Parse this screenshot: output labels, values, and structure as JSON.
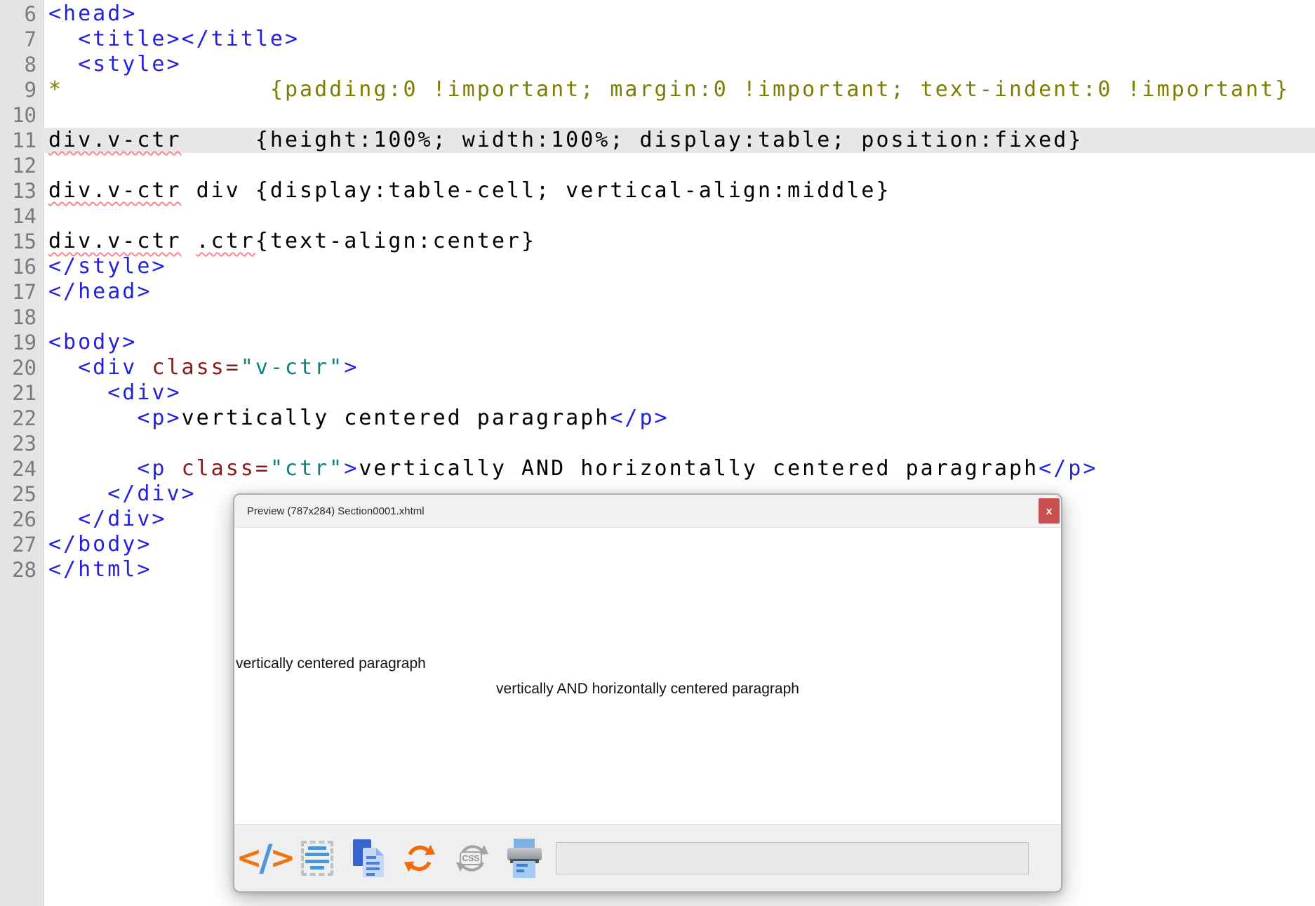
{
  "editor": {
    "lines": [
      {
        "num": "6",
        "hl": false,
        "seg": [
          [
            "tag",
            "<head>"
          ]
        ]
      },
      {
        "num": "7",
        "hl": false,
        "seg": [
          [
            "pl",
            "  "
          ],
          [
            "tag",
            "<title></title>"
          ]
        ]
      },
      {
        "num": "8",
        "hl": false,
        "seg": [
          [
            "pl",
            "  "
          ],
          [
            "tag",
            "<style>"
          ]
        ]
      },
      {
        "num": "9",
        "hl": false,
        "seg": [
          [
            "css",
            "*              {padding:0 !important; margin:0 !important; text-indent:0 !important}"
          ]
        ]
      },
      {
        "num": "10",
        "hl": false,
        "seg": []
      },
      {
        "num": "11",
        "hl": true,
        "seg": [
          [
            "sq",
            "div.v-ctr"
          ],
          [
            "pl",
            "     {height:100%; width:100%; display:table; position:fixed}"
          ]
        ]
      },
      {
        "num": "12",
        "hl": false,
        "seg": []
      },
      {
        "num": "13",
        "hl": false,
        "seg": [
          [
            "sq",
            "div.v-ctr"
          ],
          [
            "pl",
            " div {display:table-cell; vertical-align:middle}"
          ]
        ]
      },
      {
        "num": "14",
        "hl": false,
        "seg": []
      },
      {
        "num": "15",
        "hl": false,
        "seg": [
          [
            "sq",
            "div.v-ctr"
          ],
          [
            "pl",
            " "
          ],
          [
            "sq",
            ".ctr"
          ],
          [
            "pl",
            "{text-align:center}"
          ]
        ]
      },
      {
        "num": "16",
        "hl": false,
        "seg": [
          [
            "tag",
            "</style>"
          ]
        ]
      },
      {
        "num": "17",
        "hl": false,
        "seg": [
          [
            "tag",
            "</head>"
          ]
        ]
      },
      {
        "num": "18",
        "hl": false,
        "seg": []
      },
      {
        "num": "19",
        "hl": false,
        "seg": [
          [
            "tag",
            "<body>"
          ]
        ]
      },
      {
        "num": "20",
        "hl": false,
        "seg": [
          [
            "pl",
            "  "
          ],
          [
            "tag",
            "<div "
          ],
          [
            "attr",
            "class="
          ],
          [
            "val",
            "\"v-ctr\""
          ],
          [
            "tag",
            ">"
          ]
        ]
      },
      {
        "num": "21",
        "hl": false,
        "seg": [
          [
            "pl",
            "    "
          ],
          [
            "tag",
            "<div>"
          ]
        ]
      },
      {
        "num": "22",
        "hl": false,
        "seg": [
          [
            "pl",
            "      "
          ],
          [
            "tag",
            "<p>"
          ],
          [
            "pl",
            "vertically centered paragraph"
          ],
          [
            "tag",
            "</p>"
          ]
        ]
      },
      {
        "num": "23",
        "hl": false,
        "seg": []
      },
      {
        "num": "24",
        "hl": false,
        "seg": [
          [
            "pl",
            "      "
          ],
          [
            "tag",
            "<p "
          ],
          [
            "attr",
            "class="
          ],
          [
            "val",
            "\"ctr\""
          ],
          [
            "tag",
            ">"
          ],
          [
            "pl",
            "vertically AND horizontally centered paragraph"
          ],
          [
            "tag",
            "</p>"
          ]
        ]
      },
      {
        "num": "25",
        "hl": false,
        "seg": [
          [
            "pl",
            "    "
          ],
          [
            "tag",
            "</div>"
          ]
        ]
      },
      {
        "num": "26",
        "hl": false,
        "seg": [
          [
            "pl",
            "  "
          ],
          [
            "tag",
            "</div>"
          ]
        ]
      },
      {
        "num": "27",
        "hl": false,
        "seg": [
          [
            "tag",
            "</body>"
          ]
        ]
      },
      {
        "num": "28",
        "hl": false,
        "seg": [
          [
            "tag",
            "</html>"
          ]
        ]
      }
    ]
  },
  "preview_dialog": {
    "title": "Preview (787x284) Section0001.xhtml",
    "close_label": "x",
    "content": {
      "paragraph_left": "vertically centered paragraph",
      "paragraph_centered": "vertically AND horizontally centered paragraph"
    },
    "toolbar": {
      "icons": [
        "code-view-icon",
        "select-all-icon",
        "copy-icon",
        "refresh-icon",
        "inspect-css-icon",
        "print-icon"
      ],
      "code_icon_left": "<",
      "code_icon_slash": "/",
      "code_icon_right": ">",
      "css_label": "CSS",
      "input_value": "",
      "input_placeholder": ""
    }
  },
  "colors": {
    "tag_blue": "#2222dd",
    "css_olive": "#7d7d00",
    "attr_maroon": "#8b1a1a",
    "value_teal": "#0f8080",
    "squiggle_red": "#ff8585",
    "line_highlight": "#e7e7e7",
    "gutter_bg": "#e4e4e4",
    "close_red": "#c9504e",
    "refresh_orange": "#f26a0c",
    "icon_blue": "#4596dd",
    "toolbar_bg": "#efefef"
  }
}
